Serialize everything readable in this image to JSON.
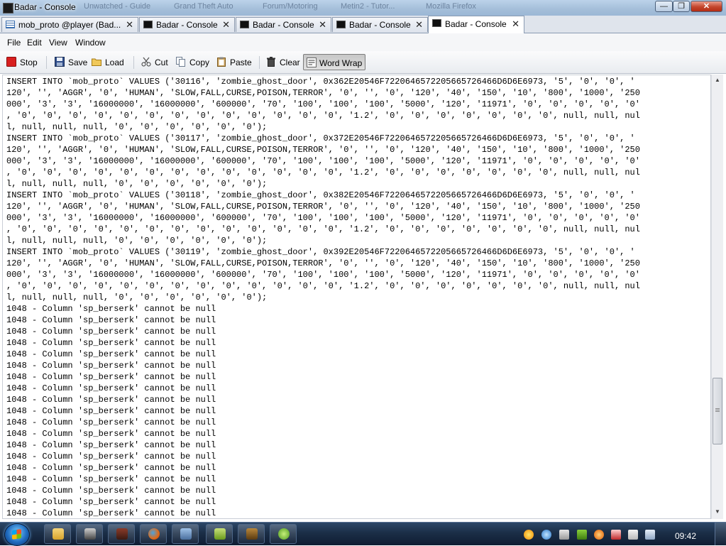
{
  "window": {
    "title": "Badar - Console",
    "background_titles": [
      "Unwatched - Guide",
      "Grand Theft Auto",
      "Forum/Motoring",
      "Metin2 - Tutor...",
      "Mozilla Firefox"
    ],
    "minimize": "—",
    "maximize": "❐",
    "close": "✕"
  },
  "tabs": [
    {
      "label": "mob_proto @player (Bad...",
      "icon": "table-icon",
      "close": "✕"
    },
    {
      "label": "Badar - Console",
      "icon": "console-icon",
      "close": "✕"
    },
    {
      "label": "Badar - Console",
      "icon": "console-icon",
      "close": "✕"
    },
    {
      "label": "Badar - Console",
      "icon": "console-icon",
      "close": "✕"
    },
    {
      "label": "Badar - Console",
      "icon": "console-icon",
      "close": "✕",
      "active": true
    }
  ],
  "menu": {
    "file": "File",
    "edit": "Edit",
    "view": "View",
    "window": "Window"
  },
  "toolbar": {
    "stop": "Stop",
    "save": "Save",
    "load": "Load",
    "cut": "Cut",
    "copy": "Copy",
    "paste": "Paste",
    "clear": "Clear",
    "word_wrap": "Word Wrap"
  },
  "console": {
    "lines": [
      "INSERT INTO `mob_proto` VALUES ('30116', 'zombie_ghost_door', 0x362E20546F7220646572205665726466D6D6E6973, '5', '0', '0', '",
      "120', '', 'AGGR', '0', 'HUMAN', 'SLOW,FALL,CURSE,POISON,TERROR', '0', '', '0', '120', '40', '150', '10', '800', '1000', '250",
      "000', '3', '3', '16000000', '16000000', '600000', '70', '100', '100', '100', '5000', '120', '11971', '0', '0', '0', '0', '0'",
      ", '0', '0', '0', '0', '0', '0', '0', '0', '0', '0', '0', '0', '0', '1.2', '0', '0', '0', '0', '0', '0', '0', null, null, nul",
      "l, null, null, null, '0', '0', '0', '0', '0', '0');",
      "INSERT INTO `mob_proto` VALUES ('30117', 'zombie_ghost_door', 0x372E20546F7220646572205665726466D6D6E6973, '5', '0', '0', '",
      "120', '', 'AGGR', '0', 'HUMAN', 'SLOW,FALL,CURSE,POISON,TERROR', '0', '', '0', '120', '40', '150', '10', '800', '1000', '250",
      "000', '3', '3', '16000000', '16000000', '600000', '70', '100', '100', '100', '5000', '120', '11971', '0', '0', '0', '0', '0'",
      ", '0', '0', '0', '0', '0', '0', '0', '0', '0', '0', '0', '0', '0', '1.2', '0', '0', '0', '0', '0', '0', '0', null, null, nul",
      "l, null, null, null, '0', '0', '0', '0', '0', '0');",
      "INSERT INTO `mob_proto` VALUES ('30118', 'zombie_ghost_door', 0x382E20546F7220646572205665726466D6D6E6973, '5', '0', '0', '",
      "120', '', 'AGGR', '0', 'HUMAN', 'SLOW,FALL,CURSE,POISON,TERROR', '0', '', '0', '120', '40', '150', '10', '800', '1000', '250",
      "000', '3', '3', '16000000', '16000000', '600000', '70', '100', '100', '100', '5000', '120', '11971', '0', '0', '0', '0', '0'",
      ", '0', '0', '0', '0', '0', '0', '0', '0', '0', '0', '0', '0', '0', '1.2', '0', '0', '0', '0', '0', '0', '0', null, null, nul",
      "l, null, null, null, '0', '0', '0', '0', '0', '0');",
      "INSERT INTO `mob_proto` VALUES ('30119', 'zombie_ghost_door', 0x392E20546F7220646572205665726466D6D6E6973, '5', '0', '0', '",
      "120', '', 'AGGR', '0', 'HUMAN', 'SLOW,FALL,CURSE,POISON,TERROR', '0', '', '0', '120', '40', '150', '10', '800', '1000', '250",
      "000', '3', '3', '16000000', '16000000', '600000', '70', '100', '100', '100', '5000', '120', '11971', '0', '0', '0', '0', '0'",
      ", '0', '0', '0', '0', '0', '0', '0', '0', '0', '0', '0', '0', '0', '1.2', '0', '0', '0', '0', '0', '0', '0', null, null, nul",
      "l, null, null, null, '0', '0', '0', '0', '0', '0');",
      "1048 - Column 'sp_berserk' cannot be null",
      "1048 - Column 'sp_berserk' cannot be null",
      "1048 - Column 'sp_berserk' cannot be null",
      "1048 - Column 'sp_berserk' cannot be null",
      "1048 - Column 'sp_berserk' cannot be null",
      "1048 - Column 'sp_berserk' cannot be null",
      "1048 - Column 'sp_berserk' cannot be null",
      "1048 - Column 'sp_berserk' cannot be null",
      "1048 - Column 'sp_berserk' cannot be null",
      "1048 - Column 'sp_berserk' cannot be null",
      "1048 - Column 'sp_berserk' cannot be null",
      "1048 - Column 'sp_berserk' cannot be null",
      "1048 - Column 'sp_berserk' cannot be null",
      "1048 - Column 'sp_berserk' cannot be null",
      "1048 - Column 'sp_berserk' cannot be null",
      "1048 - Column 'sp_berserk' cannot be null",
      "1048 - Column 'sp_berserk' cannot be null",
      "1048 - Column 'sp_berserk' cannot be null",
      "1048 - Column 'sp_berserk' cannot be null"
    ]
  },
  "scrollbar": {
    "position": 0.82
  },
  "taskbar": {
    "clock": "09:42",
    "apps": [
      "explorer-icon",
      "winamp-icon",
      "game-icon",
      "firefox-icon",
      "virtualbox-icon",
      "d-app-icon",
      "metin-icon",
      "navicat-icon"
    ],
    "tray": [
      "weather-icon",
      "network-icon",
      "volume-icon",
      "nvidia-icon",
      "antivirus-icon",
      "speaker-icon",
      "flag-icon",
      "network-status-icon"
    ]
  },
  "colors": {
    "stop_icon": "#d81f1f",
    "taskbar": "#1b2e47"
  }
}
